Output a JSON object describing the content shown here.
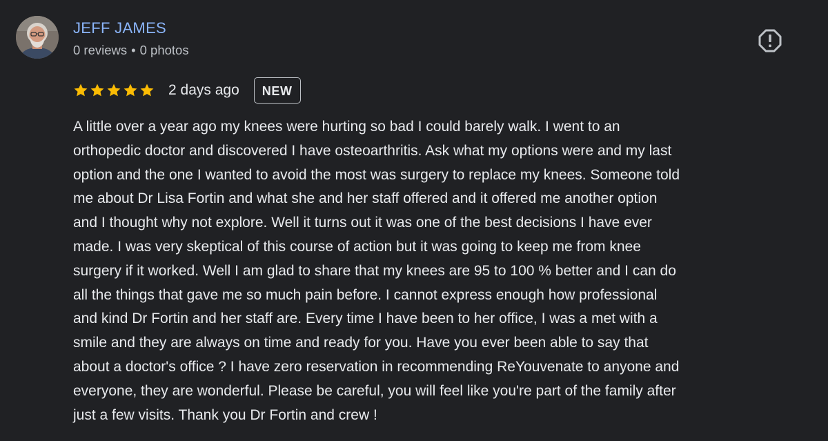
{
  "review": {
    "author": {
      "name": "JEFF JAMES",
      "reviews_count": "0 reviews",
      "separator": "•",
      "photos_count": "0 photos"
    },
    "rating": {
      "stars": 5,
      "max_stars": 5,
      "star_color": "#fbbc04"
    },
    "date": "2 days ago",
    "badge": "NEW",
    "report_icon": "report-flag-icon",
    "text_lines": [
      "A little over a year ago my knees were hurting so bad I could barely walk. I went to an",
      "orthopedic doctor and discovered I have osteoarthritis. Ask what my options were and my last",
      "option and the one I wanted to avoid the most was surgery to replace my knees. Someone told",
      "me about Dr Lisa Fortin and what she and her staff offered and it offered me another option",
      "and I thought why not explore. Well it turns out it was one of the best decisions I have ever",
      "made. I was very skeptical of this course of action but it was going to keep me from knee",
      "surgery if it worked. Well I am glad to share that my knees are 95 to 100 % better and I can do",
      "all the things that gave me so much pain before. I cannot express enough how professional",
      "and kind Dr Fortin and her staff are. Every time I have been to her office, I was a met with a",
      "smile and they are always on time and ready for you. Have you ever been able to say that",
      "about a doctor's office ? I have zero reservation in recommending ReYouvenate to anyone and",
      "everyone, they are wonderful. Please be careful, you will feel like you're part of the family after",
      "just a few visits. Thank you Dr Fortin and crew !"
    ]
  },
  "colors": {
    "background": "#202124",
    "author_link": "#8ab4f8",
    "primary_text": "#e8eaed",
    "secondary_text": "#bdc1c6"
  }
}
